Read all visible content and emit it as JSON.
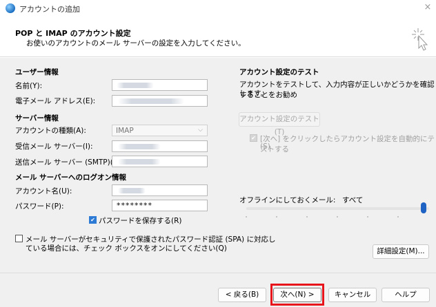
{
  "window": {
    "title": "アカウントの追加",
    "close_glyph": "×"
  },
  "header": {
    "title": "POP と IMAP のアカウント設定",
    "subtitle": "お使いのアカウントのメール サーバーの設定を入力してください。"
  },
  "user_info": {
    "heading": "ユーザー情報",
    "name_label": "名前(Y):",
    "email_label": "電子メール アドレス(E):"
  },
  "server_info": {
    "heading": "サーバー情報",
    "account_type_label": "アカウントの種類(A):",
    "account_type_value": "IMAP",
    "incoming_label": "受信メール サーバー(I):",
    "outgoing_label": "送信メール サーバー (SMTP)(O):"
  },
  "logon_info": {
    "heading": "メール サーバーへのログオン情報",
    "account_name_label": "アカウント名(U):",
    "password_label": "パスワード(P):",
    "password_value": "********",
    "remember_password_label": "パスワードを保存する(R)",
    "remember_password_checked": true,
    "spa_label_line1": "メール サーバーがセキュリティで保護されたパスワード認証 (SPA) に対応し",
    "spa_label_line2": "ている場合には、チェック ボックスをオンにしてください(Q)",
    "spa_checked": false
  },
  "test_settings": {
    "heading": "アカウント設定のテスト",
    "description_line1": "アカウントをテストして、入力内容が正しいかどうかを確認することをお勧め",
    "description_line2": "します。",
    "test_button": "アカウント設定のテスト(T)",
    "auto_test_line1": "[次へ] をクリックしたらアカウント設定を自動的にテストする",
    "auto_test_line2": "(S)",
    "auto_test_checked": true
  },
  "offline": {
    "label": "オフラインにしておくメール:",
    "value": "すべて",
    "slider_level_percent": 100
  },
  "more_settings_button": "詳細設定(M)...",
  "footer": {
    "back_button": "< 戻る(B)",
    "next_button": "次へ(N) >",
    "cancel_button": "キャンセル",
    "help_button": "ヘルプ"
  },
  "colors": {
    "accent": "#1e63c4",
    "highlight_box": "#e8141b"
  }
}
